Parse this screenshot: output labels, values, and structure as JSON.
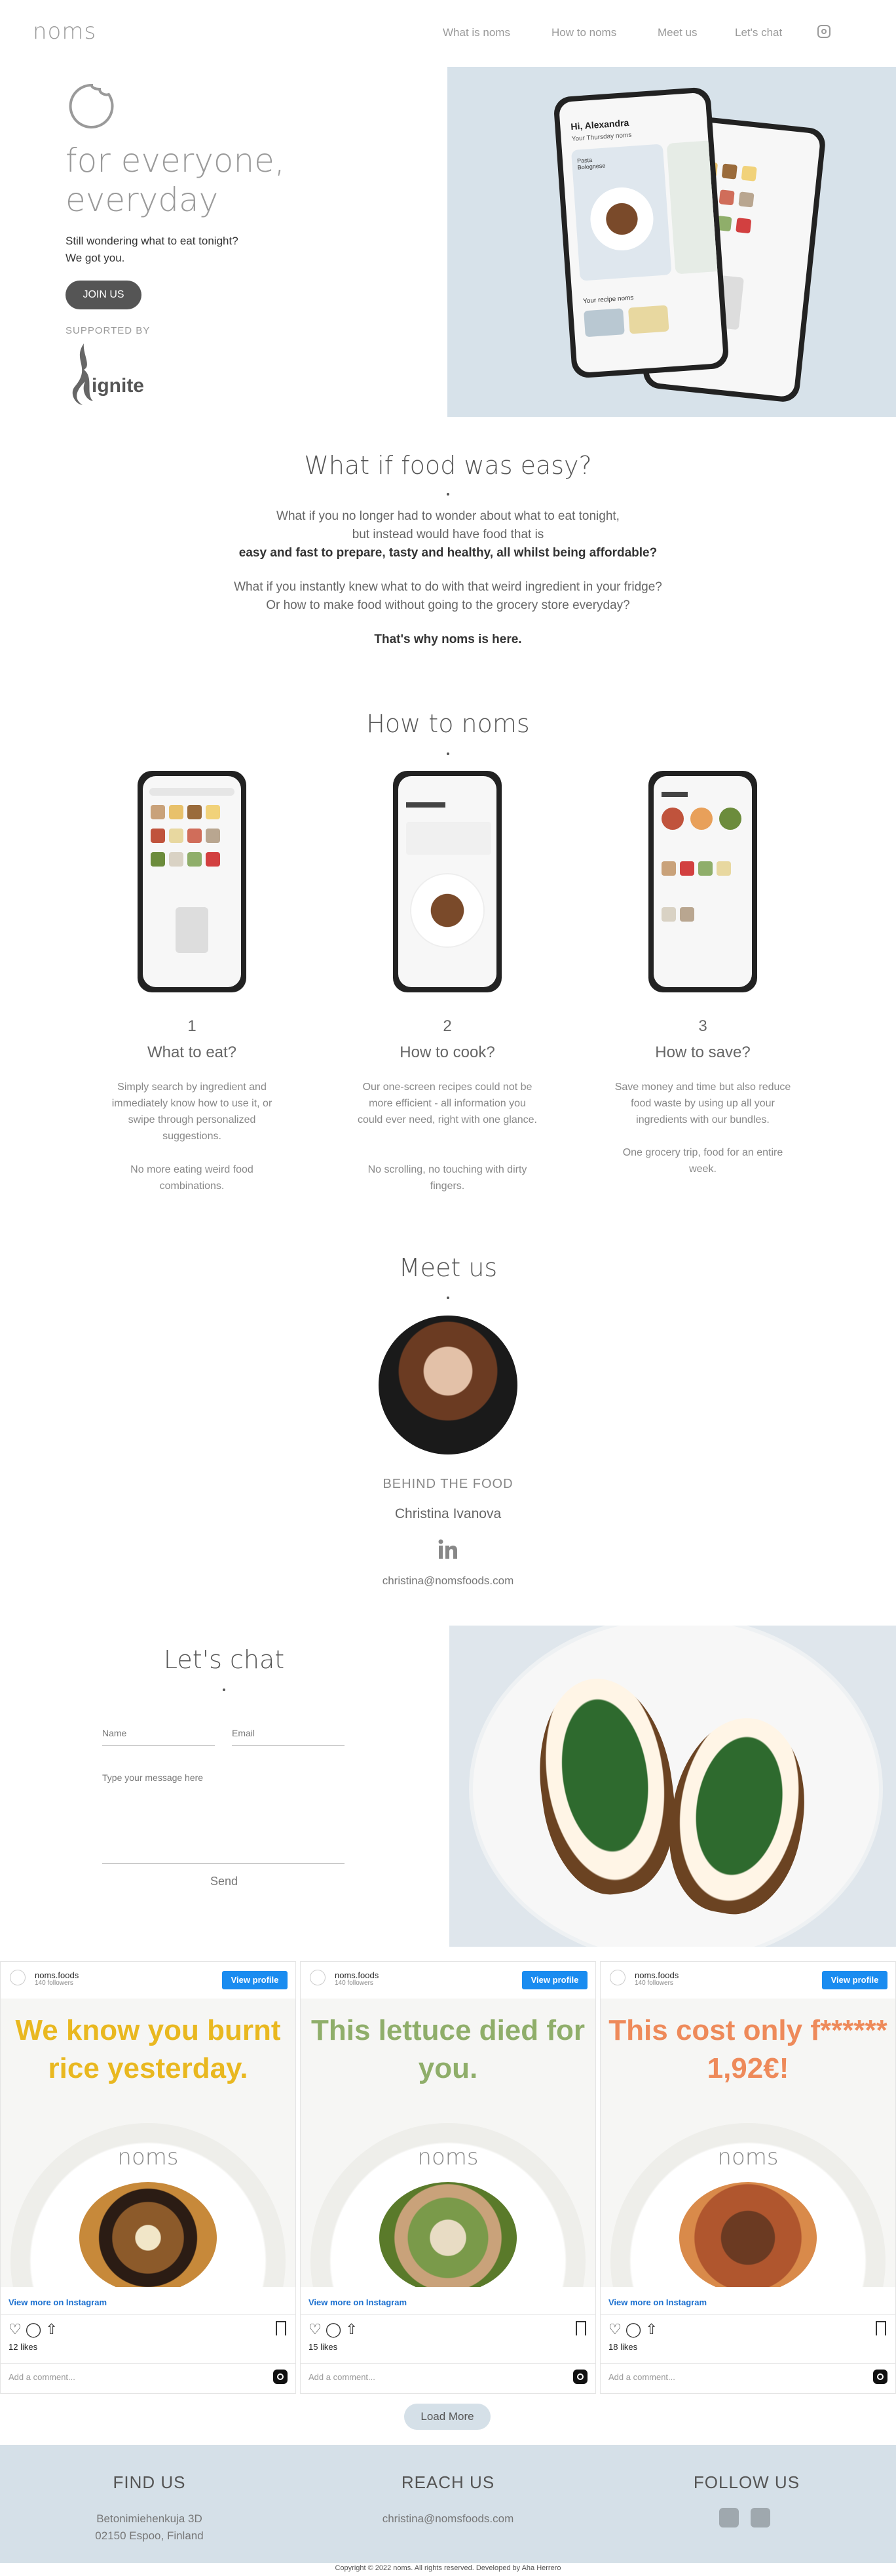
{
  "header": {
    "logo": "noms",
    "nav": [
      "What is noms",
      "How to noms",
      "Meet us",
      "Let's chat"
    ]
  },
  "hero": {
    "title_line1": "for everyone,",
    "title_line2": "everyday",
    "sub_line1": "Still wondering what to eat tonight?",
    "sub_line2": "We got you.",
    "join": "JOIN US",
    "supported": "SUPPORTED BY",
    "sponsor": "ignite",
    "phone_greeting": "Hi, Alexandra",
    "phone_sub": "Your Thursday noms",
    "phone_dish": "Pasta Bolognese",
    "phone_recipes": "Your recipe noms"
  },
  "easy": {
    "title": "What if food was easy?",
    "p1_l1": "What if you no longer had to wonder about what to eat tonight,",
    "p1_l2": "but instead would have food that is",
    "p1_l3": "easy and fast to prepare, tasty and healthy, all whilst being affordable?",
    "p2_l1": "What if you instantly knew what to do with that weird ingredient in your fridge?",
    "p2_l2": "Or how to make food without going to the grocery store everyday?",
    "p3": "That's why noms is here."
  },
  "how": {
    "title": "How to noms",
    "steps": [
      {
        "num": "1",
        "title": "What to eat?",
        "d1": "Simply search by ingredient and immediately know how to use it, or swipe through personalized suggestions.",
        "d2": "No more eating weird food combinations."
      },
      {
        "num": "2",
        "title": "How to cook?",
        "d1": "Our one-screen recipes could not be more efficient - all information you could ever need, right with one glance.",
        "d2": "No scrolling, no touching with dirty fingers."
      },
      {
        "num": "3",
        "title": "How to save?",
        "d1": "Save money and time but also reduce food waste by using up all your ingredients with our bundles.",
        "d2": "One grocery trip, food for an entire week."
      }
    ]
  },
  "meet": {
    "title": "Meet us",
    "role": "BEHIND THE FOOD",
    "name": "Christina Ivanova",
    "email": "christina@nomsfoods.com"
  },
  "chat": {
    "title": "Let's chat",
    "name_placeholder": "Name",
    "email_placeholder": "Email",
    "message_placeholder": "Type your message here",
    "send": "Send"
  },
  "instagram": {
    "posts": [
      {
        "account": "noms.foods",
        "followers": "140 followers",
        "view": "View profile",
        "caption": "We know you burnt rice yesterday.",
        "caption_color": "#e9b820",
        "brand": "noms",
        "view_more": "View more on Instagram",
        "likes": "12 likes",
        "comment": "Add a comment..."
      },
      {
        "account": "noms.foods",
        "followers": "140 followers",
        "view": "View profile",
        "caption": "This lettuce died for you.",
        "caption_color": "#8fae6a",
        "brand": "noms",
        "view_more": "View more on Instagram",
        "likes": "15 likes",
        "comment": "Add a comment..."
      },
      {
        "account": "noms.foods",
        "followers": "140 followers",
        "view": "View profile",
        "caption": "This cost only f****** 1,92€!",
        "caption_color": "#ee8a5a",
        "brand": "noms",
        "view_more": "View more on Instagram",
        "likes": "18 likes",
        "comment": "Add a comment..."
      }
    ],
    "load_more": "Load More"
  },
  "footer": {
    "find_title": "FIND US",
    "address_l1": "Betonimiehenkuja 3D",
    "address_l2": "02150 Espoo, Finland",
    "reach_title": "REACH US",
    "reach_email": "christina@nomsfoods.com",
    "follow_title": "FOLLOW US",
    "copyright": "Copyright © 2022 noms. All rights reserved. Developed by Aha Herrero"
  }
}
